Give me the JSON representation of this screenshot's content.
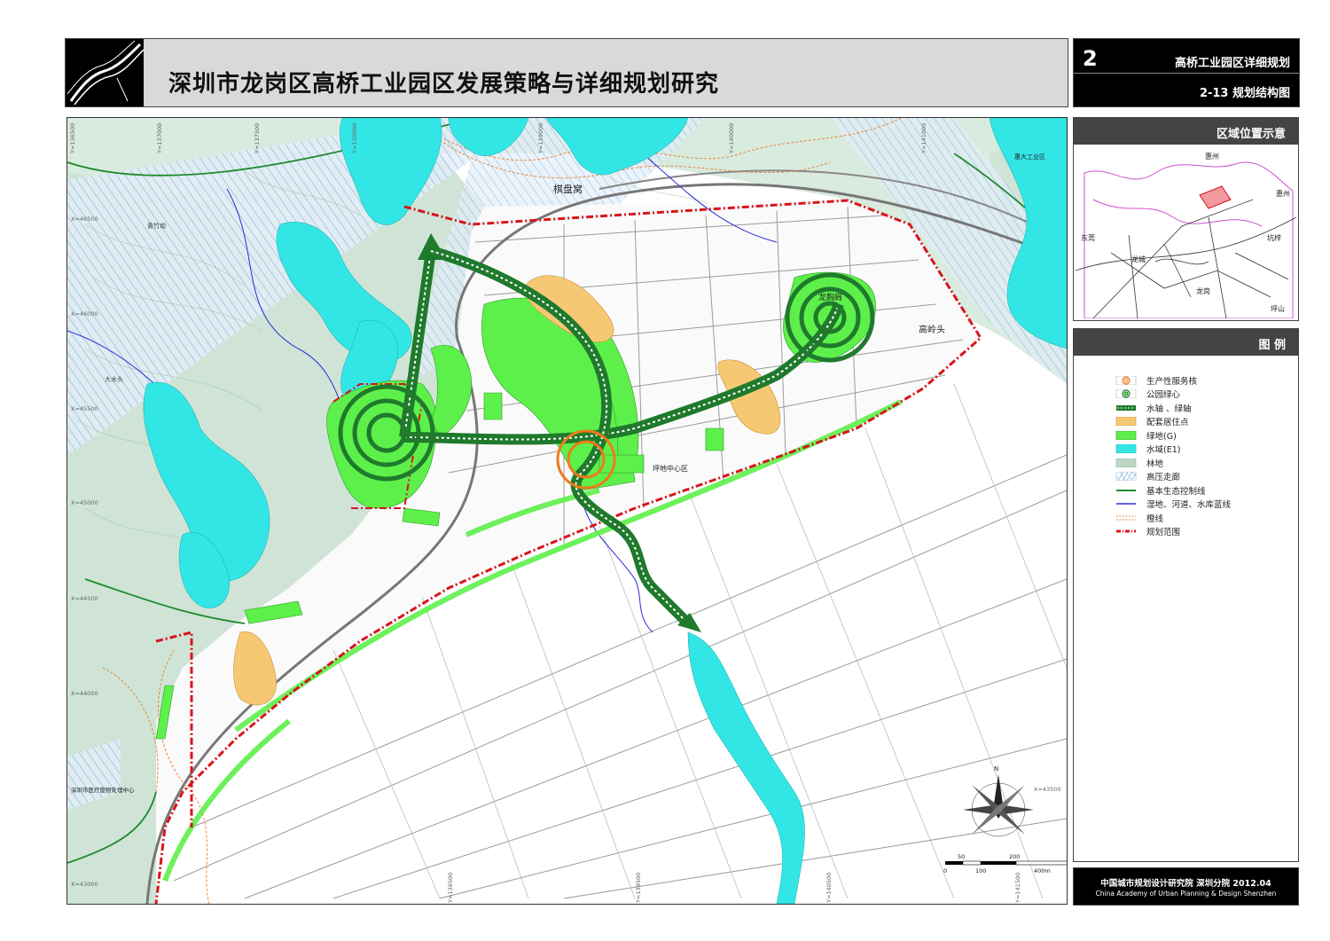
{
  "header": {
    "title": "深圳市龙岗区高桥工业园区发展策略与详细规划研究"
  },
  "sheet": {
    "number": "2",
    "title": "高桥工业园区详细规划",
    "subtitle": "2-13 规划结构图"
  },
  "location_panel": {
    "title": "区域位置示意",
    "labels": [
      "惠州",
      "惠州",
      "东莞",
      "坑梓",
      "龙岗",
      "坪山",
      "龙城"
    ]
  },
  "legend": {
    "title": "图  例",
    "items": [
      {
        "label": "生产性服务核",
        "symbol": "orange-rings"
      },
      {
        "label": "公园绿心",
        "symbol": "green-rings"
      },
      {
        "label": "水轴 、绿轴",
        "symbol": "axis-arrow"
      },
      {
        "label": "配套居住点",
        "symbol": "orange-fill"
      },
      {
        "label": "绿地(G)",
        "symbol": "green-fill"
      },
      {
        "label": "水域(E1)",
        "symbol": "cyan-fill"
      },
      {
        "label": "林地",
        "symbol": "forest-fill"
      },
      {
        "label": "高压走廊",
        "symbol": "hatch"
      },
      {
        "label": "基本生态控制线",
        "symbol": "green-line"
      },
      {
        "label": "湿地、河道、水库蓝线",
        "symbol": "blue-line"
      },
      {
        "label": "橙线",
        "symbol": "orange-dash"
      },
      {
        "label": "规划范围",
        "symbol": "red-dash"
      }
    ]
  },
  "footer": {
    "cn": "中国城市规划设计研究院 深圳分院   2012.04",
    "en": "China Academy of Urban Planning & Design Shenzhen"
  },
  "map": {
    "place_labels": [
      "棋盘窝",
      "黄竹坳",
      "大水头",
      "高岭头",
      "龙胸肩",
      "坪地中心区",
      "深圳市医疗废物处理中心",
      "惠大工业区"
    ],
    "x_coords": [
      "X=46500",
      "X=46000",
      "X=45500",
      "X=45000",
      "X=44500",
      "X=44000",
      "X=43500",
      "X=43000"
    ],
    "y_coords": [
      "Y=136500",
      "Y=137000",
      "Y=137500",
      "Y=138000",
      "Y=138500",
      "Y=139000",
      "Y=139500",
      "Y=140000",
      "Y=140500",
      "Y=141000",
      "Y=141500"
    ],
    "scale_labels": [
      "0",
      "50",
      "100",
      "200",
      "400m"
    ],
    "north_label": "N"
  },
  "colors": {
    "forest": "#cfe4d6",
    "water": "#2ee8e8",
    "greenland": "#5ef04a",
    "residential": "#f7c873",
    "axis": "#1f7a2c",
    "boundary": "#d9141b",
    "blue_line": "#2b2bd9",
    "orange_line": "#e8873a",
    "hatch": "#a9cbe8"
  }
}
